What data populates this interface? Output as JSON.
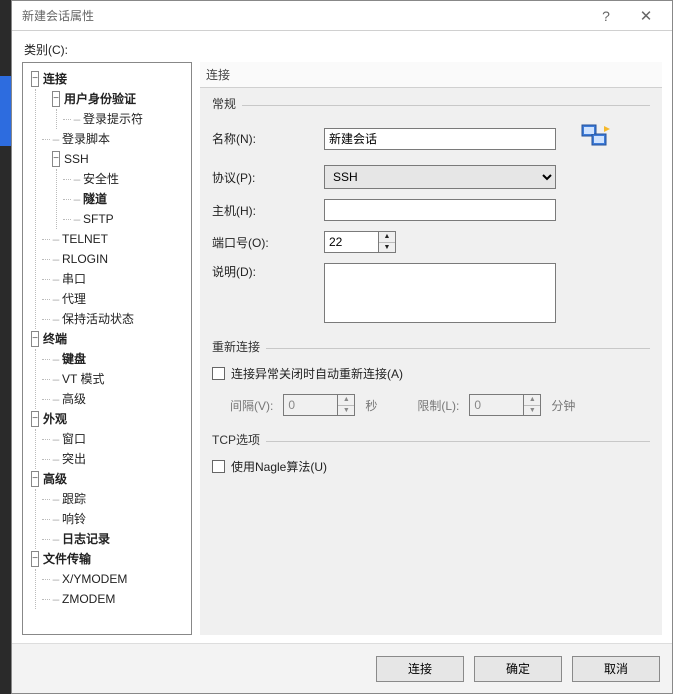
{
  "window": {
    "title": "新建会话属性",
    "help": "?",
    "close": "✕"
  },
  "category_label": "类别(C):",
  "tree": {
    "connection": {
      "label": "连接",
      "auth": {
        "label": "用户身份验证",
        "prompt": "登录提示符"
      },
      "login_script": "登录脚本",
      "ssh": {
        "label": "SSH",
        "security": "安全性",
        "tunnel": "隧道",
        "sftp": "SFTP"
      },
      "telnet": "TELNET",
      "rlogin": "RLOGIN",
      "serial": "串口",
      "proxy": "代理",
      "keepalive": "保持活动状态"
    },
    "terminal": {
      "label": "终端",
      "keyboard": "键盘",
      "vtmode": "VT 模式",
      "advanced": "高级"
    },
    "appearance": {
      "label": "外观",
      "window": "窗口",
      "highlight": "突出"
    },
    "advanced": {
      "label": "高级",
      "trace": "跟踪",
      "bell": "响铃",
      "logging": "日志记录"
    },
    "filetransfer": {
      "label": "文件传输",
      "xymodem": "X/YMODEM",
      "zmodem": "ZMODEM"
    }
  },
  "right_title": "连接",
  "groups": {
    "general": {
      "title": "常规",
      "name_label": "名称(N):",
      "name_value": "新建会话",
      "protocol_label": "协议(P):",
      "protocol_value": "SSH",
      "host_label": "主机(H):",
      "host_value": "",
      "port_label": "端口号(O):",
      "port_value": "22",
      "desc_label": "说明(D):",
      "desc_value": ""
    },
    "reconnect": {
      "title": "重新连接",
      "chk_label": "连接异常关闭时自动重新连接(A)",
      "interval_label": "间隔(V):",
      "interval_value": "0",
      "interval_unit": "秒",
      "limit_label": "限制(L):",
      "limit_value": "0",
      "limit_unit": "分钟"
    },
    "tcp": {
      "title": "TCP选项",
      "nagle_label": "使用Nagle算法(U)"
    }
  },
  "footer": {
    "connect": "连接",
    "ok": "确定",
    "cancel": "取消"
  }
}
